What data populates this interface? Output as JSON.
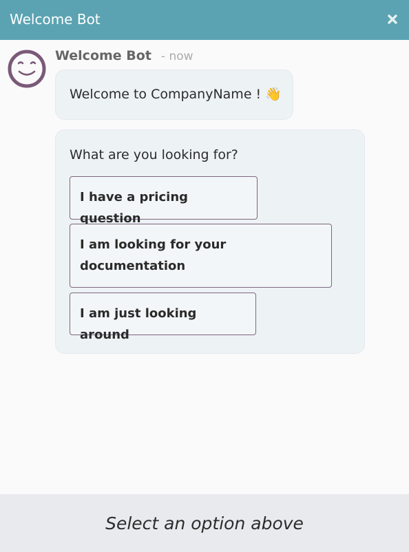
{
  "header": {
    "title": "Welcome Bot",
    "close_icon": "close-icon"
  },
  "colors": {
    "header_bg": "#5ba3b2",
    "avatar_accent": "#7a5a78",
    "bubble_bg": "#edf2f5",
    "option_border": "#7b667f"
  },
  "message": {
    "author": "Welcome Bot",
    "timestamp": "- now",
    "avatar_icon": "smiley-face-icon",
    "welcome_text": "Welcome to CompanyName !",
    "welcome_emoji": "👋",
    "question": "What are you looking for?",
    "options": [
      {
        "label": "I have a pricing question"
      },
      {
        "label": "I am looking for your documentation"
      },
      {
        "label": "I am just looking around"
      }
    ]
  },
  "footer": {
    "hint": "Select an option above"
  }
}
